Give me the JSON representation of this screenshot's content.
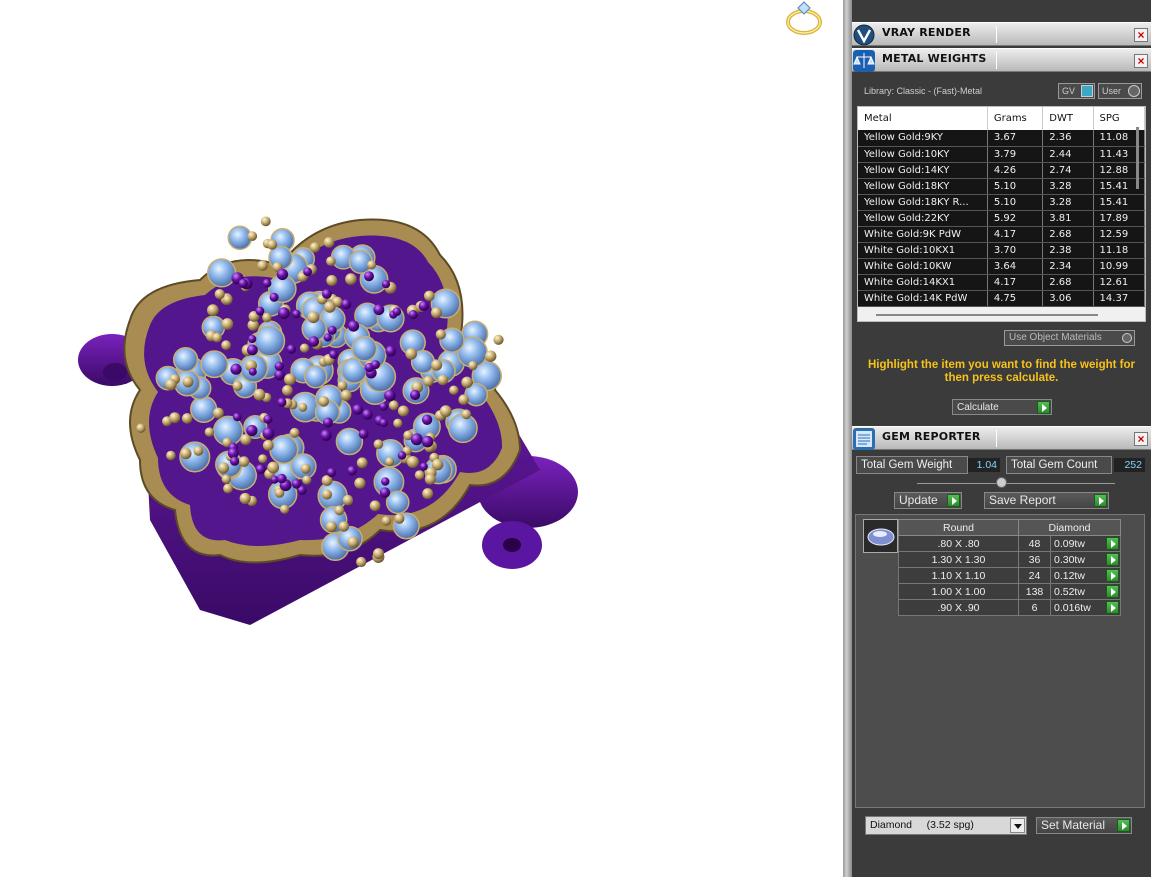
{
  "vray": {
    "title": "VRAY RENDER",
    "close": "×"
  },
  "metal": {
    "title": "METAL WEIGHTS",
    "close": "×",
    "library": "Library: Classic - (Fast)-Metal",
    "toggle_gv": "GV",
    "toggle_user": "User",
    "columns": [
      "Metal",
      "Grams",
      "DWT",
      "SPG"
    ],
    "rows": [
      [
        "Yellow Gold:9KY",
        "3.67",
        "2.36",
        "11.08"
      ],
      [
        "Yellow Gold:10KY",
        "3.79",
        "2.44",
        "11.43"
      ],
      [
        "Yellow Gold:14KY",
        "4.26",
        "2.74",
        "12.88"
      ],
      [
        "Yellow Gold:18KY",
        "5.10",
        "3.28",
        "15.41"
      ],
      [
        "Yellow Gold:18KY R...",
        "5.10",
        "3.28",
        "15.41"
      ],
      [
        "Yellow Gold:22KY",
        "5.92",
        "3.81",
        "17.89"
      ],
      [
        "White Gold:9K PdW",
        "4.17",
        "2.68",
        "12.59"
      ],
      [
        "White Gold:10KX1",
        "3.70",
        "2.38",
        "11.18"
      ],
      [
        "White Gold:10KW",
        "3.64",
        "2.34",
        "10.99"
      ],
      [
        "White Gold:14KX1",
        "4.17",
        "2.68",
        "12.61"
      ],
      [
        "White Gold:14K PdW",
        "4.75",
        "3.06",
        "14.37"
      ]
    ],
    "use_object_materials": "Use Object Materials",
    "instruction": "Highlight the item you want to find the weight for then press calculate.",
    "calculate": "Calculate"
  },
  "gem": {
    "title": "GEM REPORTER",
    "close": "×",
    "total_weight_label": "Total Gem Weight",
    "total_weight_value": "1.04",
    "total_count_label": "Total Gem Count",
    "total_count_value": "252",
    "update": "Update",
    "save_report": "Save Report",
    "columns": [
      "Round",
      "Diamond"
    ],
    "rows": [
      [
        ".80 X .80",
        "48",
        "0.09tw"
      ],
      [
        "1.30 X 1.30",
        "36",
        "0.30tw"
      ],
      [
        "1.10 X 1.10",
        "24",
        "0.12tw"
      ],
      [
        "1.00 X 1.00",
        "138",
        "0.52tw"
      ],
      [
        ".90 X .90",
        "6",
        "0.016tw"
      ]
    ],
    "material": "Diamond     (3.52 spg)",
    "set_material": "Set Material"
  },
  "colors": {
    "accent_text": "#f7c21a",
    "value_text": "#7fd6ff",
    "purple": "#6a12a8",
    "gold": "#c9ae74",
    "stone": "#8fb8ec"
  }
}
